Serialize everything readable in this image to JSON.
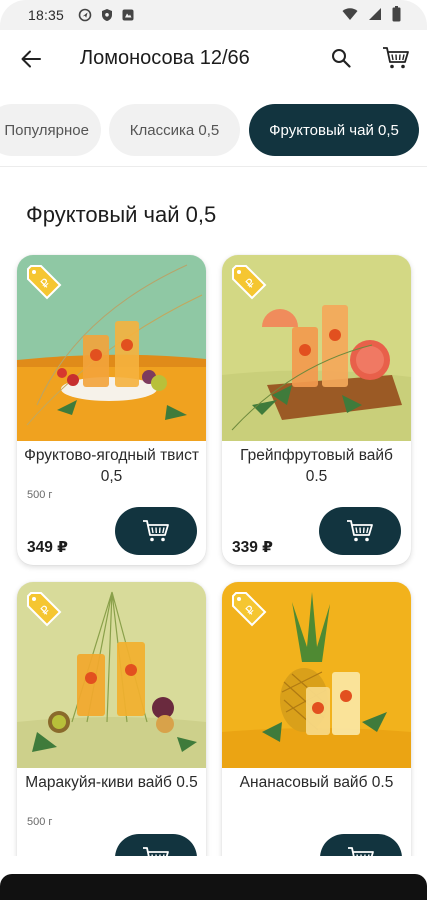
{
  "status_bar": {
    "time": "18:35",
    "icons": [
      "location-icon",
      "shield-icon",
      "notification-icon",
      "wifi-icon",
      "signal-icon",
      "battery-icon"
    ]
  },
  "header": {
    "title": "Ломоносова 12/66"
  },
  "categories": [
    {
      "label": "Популярное",
      "selected": false
    },
    {
      "label": "Классика 0,5",
      "selected": false
    },
    {
      "label": "Фруктовый чай 0,5",
      "selected": true
    }
  ],
  "section_title": "Фруктовый чай 0,5",
  "products": [
    {
      "name": "Фруктово-ягодный твист 0,5",
      "weight": "500 г",
      "price": "349 ₽",
      "badge": "promo"
    },
    {
      "name": "Грейпфрутовый вайб 0.5",
      "weight": "",
      "price": "339 ₽",
      "badge": "promo"
    },
    {
      "name": "Маракуйя-киви вайб 0.5",
      "weight": "500 г",
      "price": "",
      "badge": "promo"
    },
    {
      "name": "Ананасовый вайб 0.5",
      "weight": "",
      "price": "",
      "badge": "promo"
    }
  ],
  "colors": {
    "accent": "#12343f",
    "chip_bg": "#f1f1f1",
    "badge": "#f5c631"
  }
}
